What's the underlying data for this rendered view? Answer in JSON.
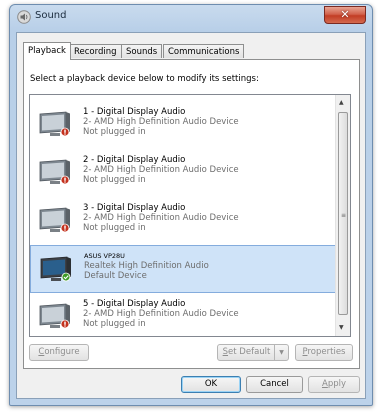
{
  "window": {
    "title": "Sound",
    "close_label": "✕"
  },
  "tabs": [
    {
      "label": "Playback",
      "active": true
    },
    {
      "label": "Recording",
      "active": false
    },
    {
      "label": "Sounds",
      "active": false
    },
    {
      "label": "Communications",
      "active": false
    }
  ],
  "instruction": "Select a playback device below to modify its settings:",
  "devices": [
    {
      "name": "1 - Digital Display Audio",
      "driver": "2- AMD High Definition Audio Device",
      "status": "Not plugged in",
      "state": "unplugged"
    },
    {
      "name": "2 - Digital Display Audio",
      "driver": "2- AMD High Definition Audio Device",
      "status": "Not plugged in",
      "state": "unplugged"
    },
    {
      "name": "3 - Digital Display Audio",
      "driver": "2- AMD High Definition Audio Device",
      "status": "Not plugged in",
      "state": "unplugged"
    },
    {
      "name": "ASUS VP28U",
      "driver": "Realtek High Definition Audio",
      "status": "Default Device",
      "state": "default"
    },
    {
      "name": "5 - Digital Display Audio",
      "driver": "2- AMD High Definition Audio Device",
      "status": "Not plugged in",
      "state": "unplugged"
    }
  ],
  "buttons": {
    "configure": "Configure",
    "configure_key": "C",
    "configure_rest": "onfigure",
    "set_default_key": "S",
    "set_default_rest": "et Default",
    "split_arrow": "▼",
    "properties_key": "P",
    "properties_rest": "roperties",
    "ok": "OK",
    "cancel": "Cancel",
    "apply_key": "A",
    "apply_rest": "pply"
  },
  "colors": {
    "unplugged_badge": "#c4321f",
    "default_badge": "#3f9b28"
  }
}
